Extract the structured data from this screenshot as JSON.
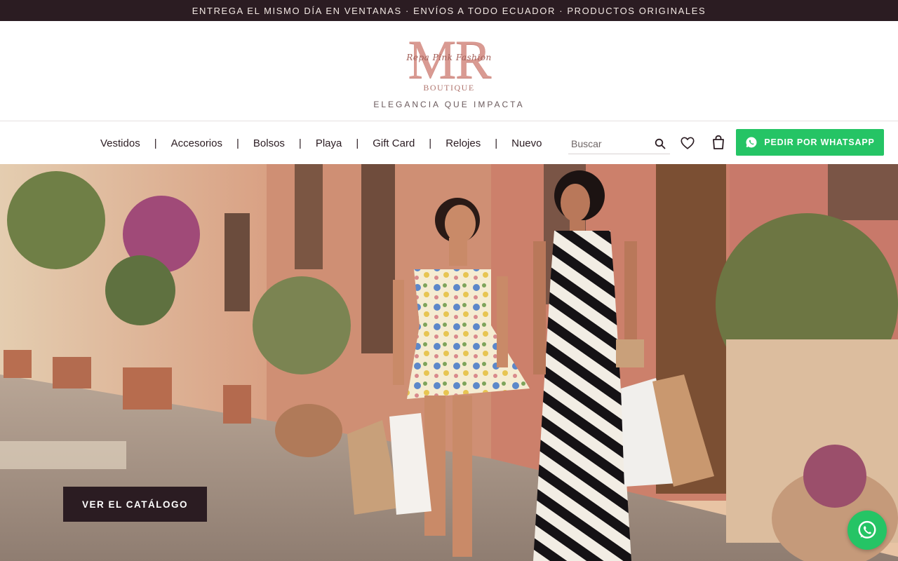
{
  "announcement": "ENTREGA EL MISMO DÍA EN VENTANAS · ENVÍOS A TODO ECUADOR · PRODUCTOS ORIGINALES",
  "logo": {
    "letters": "MR",
    "script": "Repa Pink Fashion",
    "boutique": "BOUTIQUE",
    "tagline": "ELEGANCIA QUE IMPACTA",
    "color": "#d99a92"
  },
  "nav": {
    "items": [
      "Vestidos",
      "Accesorios",
      "Bolsos",
      "Playa",
      "Gift Card",
      "Relojes",
      "Nuevo"
    ],
    "separator": "|"
  },
  "search": {
    "placeholder": "Buscar",
    "value": "",
    "icon": "search-icon"
  },
  "icons": {
    "wishlist": "heart-icon",
    "cart": "shopping-bag-icon",
    "whatsapp": "whatsapp-icon"
  },
  "whatsapp_button": {
    "label": "PEDIR POR WHATSAPP",
    "color": "#25c465"
  },
  "hero": {
    "image": "two-women-shopping-street-photo",
    "cta_label": "VER EL CATÁLOGO"
  },
  "colors": {
    "dark": "#2b1c22",
    "accent": "#25c465",
    "brand": "#d99a92"
  }
}
